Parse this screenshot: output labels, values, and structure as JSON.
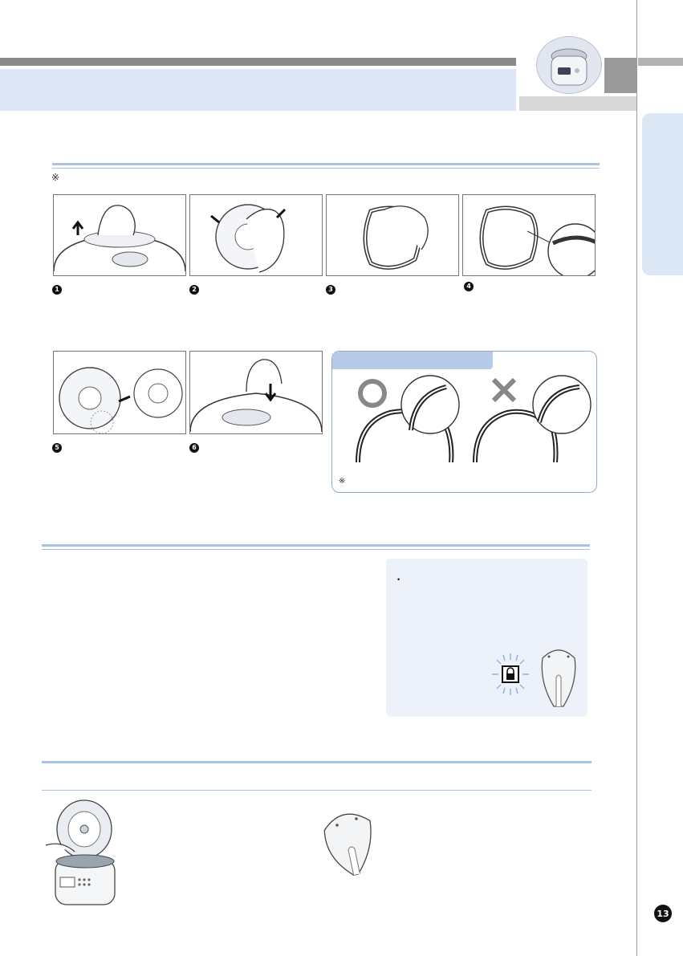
{
  "header": {
    "thumbnail_icon": "rice-cooker-icon"
  },
  "notes": {
    "disassembly_mark": "※",
    "panel_mark": "※"
  },
  "steps": [
    {
      "num": "1",
      "icon": "lift-handle-illustration"
    },
    {
      "num": "2",
      "icon": "press-tabs-illustration"
    },
    {
      "num": "3",
      "icon": "remove-gasket-illustration"
    },
    {
      "num": "4",
      "icon": "reinsert-gasket-illustration"
    },
    {
      "num": "5",
      "icon": "reattach-cover-illustration"
    },
    {
      "num": "6",
      "icon": "press-down-illustration"
    }
  ],
  "correct_panel": {
    "ok_symbol": "circle-icon",
    "ng_symbol": "cross-icon"
  },
  "info_panel": {
    "bullet": "•",
    "lock_icon": "lock-icon",
    "part_icon": "steam-cap-icon"
  },
  "bottom_section": {
    "cooker_icon": "open-rice-cooker-illustration",
    "cap_icon": "steam-cap-illustration"
  },
  "page_number": "13",
  "colors": {
    "accent_blue": "#a9c3e6",
    "band_blue": "#dce6f4",
    "gray": "#8a8a8a"
  }
}
